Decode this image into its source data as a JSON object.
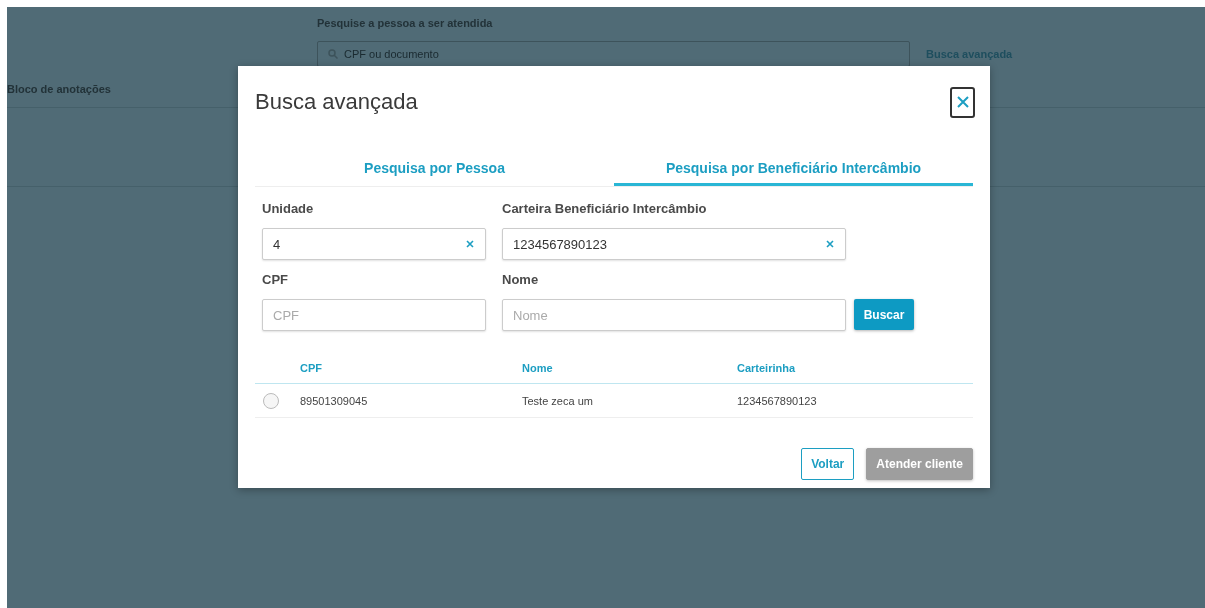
{
  "background": {
    "search_label": "Pesquise a pessoa a ser atendida",
    "search_placeholder": "CPF ou documento",
    "advanced_link": "Busca avançada",
    "notes_title": "Bloco de anotações"
  },
  "modal": {
    "title": "Busca avançada",
    "tabs": [
      {
        "label": "Pesquisa por Pessoa",
        "selected": false
      },
      {
        "label": "Pesquisa por Beneficiário Intercâmbio",
        "selected": true
      }
    ],
    "fields": [
      {
        "label": "Unidade",
        "value": "4",
        "clearable": true
      },
      {
        "label": "Carteira Beneficiário Intercâmbio",
        "value": "1234567890123",
        "clearable": true
      },
      {
        "label": "CPF",
        "placeholder": "CPF",
        "clearable": false
      },
      {
        "label": "Nome",
        "placeholder": "Nome",
        "clearable": false
      }
    ],
    "search_button": "Buscar",
    "table": {
      "columns": [
        "CPF",
        "Nome",
        "Carteirinha"
      ],
      "rows": [
        {
          "selected": false,
          "cells": [
            "89501309045",
            "Teste zeca um",
            "1234567890123"
          ]
        }
      ]
    },
    "buttons": [
      {
        "label": "Voltar",
        "kind": "secondary",
        "disabled": false
      },
      {
        "label": "Atender cliente",
        "kind": "primary",
        "disabled": true
      }
    ]
  }
}
